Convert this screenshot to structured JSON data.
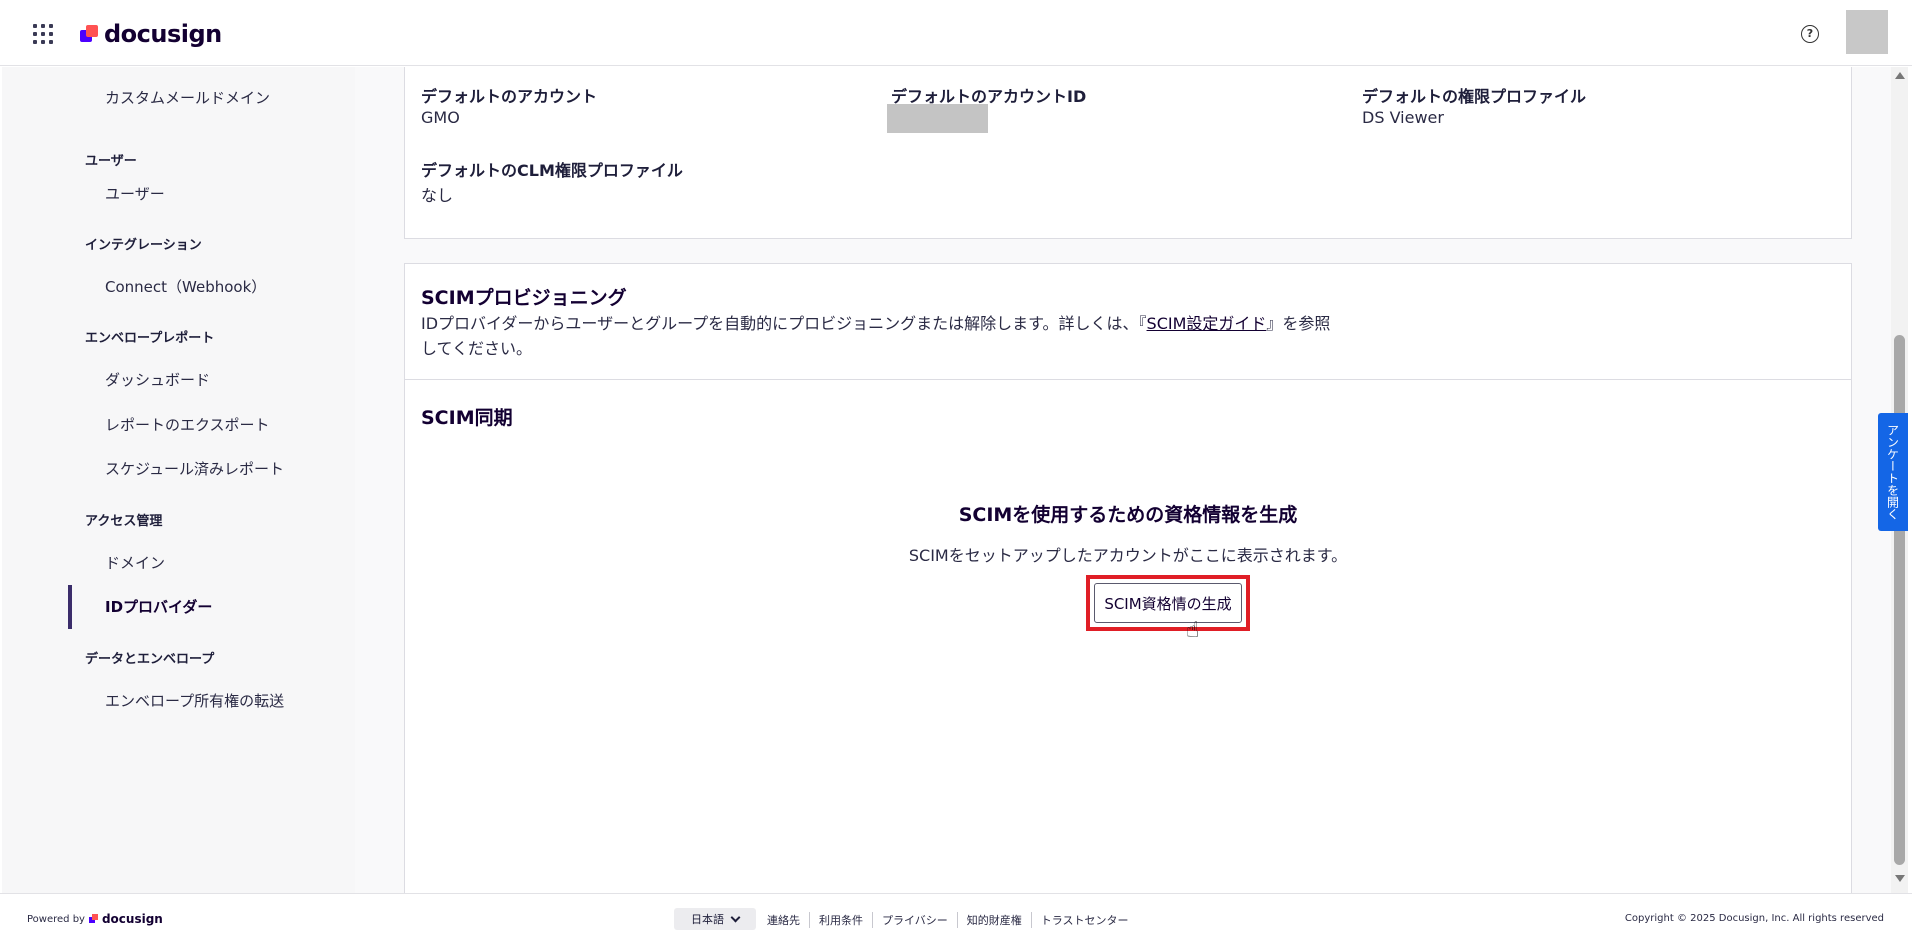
{
  "header": {
    "logo_text": "docusign",
    "help_icon_glyph": "?"
  },
  "sidebar": {
    "items": [
      {
        "type": "item",
        "label": "カスタムメールドメイン"
      },
      {
        "type": "heading",
        "label": "ユーザー"
      },
      {
        "type": "item",
        "label": "ユーザー"
      },
      {
        "type": "heading",
        "label": "インテグレーション"
      },
      {
        "type": "item",
        "label": "Connect（Webhook）"
      },
      {
        "type": "heading",
        "label": "エンベロープレポート"
      },
      {
        "type": "item",
        "label": "ダッシュボード"
      },
      {
        "type": "item",
        "label": "レポートのエクスポート"
      },
      {
        "type": "item",
        "label": "スケジュール済みレポート"
      },
      {
        "type": "heading",
        "label": "アクセス管理"
      },
      {
        "type": "item",
        "label": "ドメイン"
      },
      {
        "type": "item",
        "label": "IDプロバイダー",
        "active": true
      },
      {
        "type": "heading",
        "label": "データとエンベロープ"
      },
      {
        "type": "item",
        "label": "エンベロープ所有権の転送"
      }
    ]
  },
  "defaults_card": {
    "default_account_label": "デフォルトのアカウント",
    "default_account_value": "GMO",
    "default_account_id_label": "デフォルトのアカウントID",
    "default_permission_label": "デフォルトの権限プロファイル",
    "default_permission_value": "DS Viewer",
    "default_clm_label": "デフォルトのCLM権限プロファイル",
    "default_clm_value": "なし"
  },
  "scim_card": {
    "title": "SCIMプロビジョニング",
    "desc_before": "IDプロバイダーからユーザーとグループを自動的にプロビジョニングまたは解除します。詳しくは、『",
    "desc_link": "SCIM設定ガイド",
    "desc_after": "』を参照してください。",
    "sync_title": "SCIM同期",
    "empty_title": "SCIMを使用するための資格情報を生成",
    "empty_subtitle": "SCIMをセットアップしたアカウントがここに表示されます。",
    "generate_button": "SCIM資格情の生成"
  },
  "survey_tab": "アンケートを開く",
  "footer": {
    "powered_by": "Powered by",
    "powered_logo": "docusign",
    "language": "日本語",
    "links": [
      "連絡先",
      "利用条件",
      "プライバシー",
      "知的財産権",
      "トラストセンター"
    ],
    "copyright": "Copyright © 2025 Docusign, Inc. All rights reserved"
  },
  "colors": {
    "brand_purple": "#4c00ff",
    "brand_coral": "#ff5252",
    "highlight_red": "#e01e26",
    "survey_blue": "#1466e6"
  }
}
